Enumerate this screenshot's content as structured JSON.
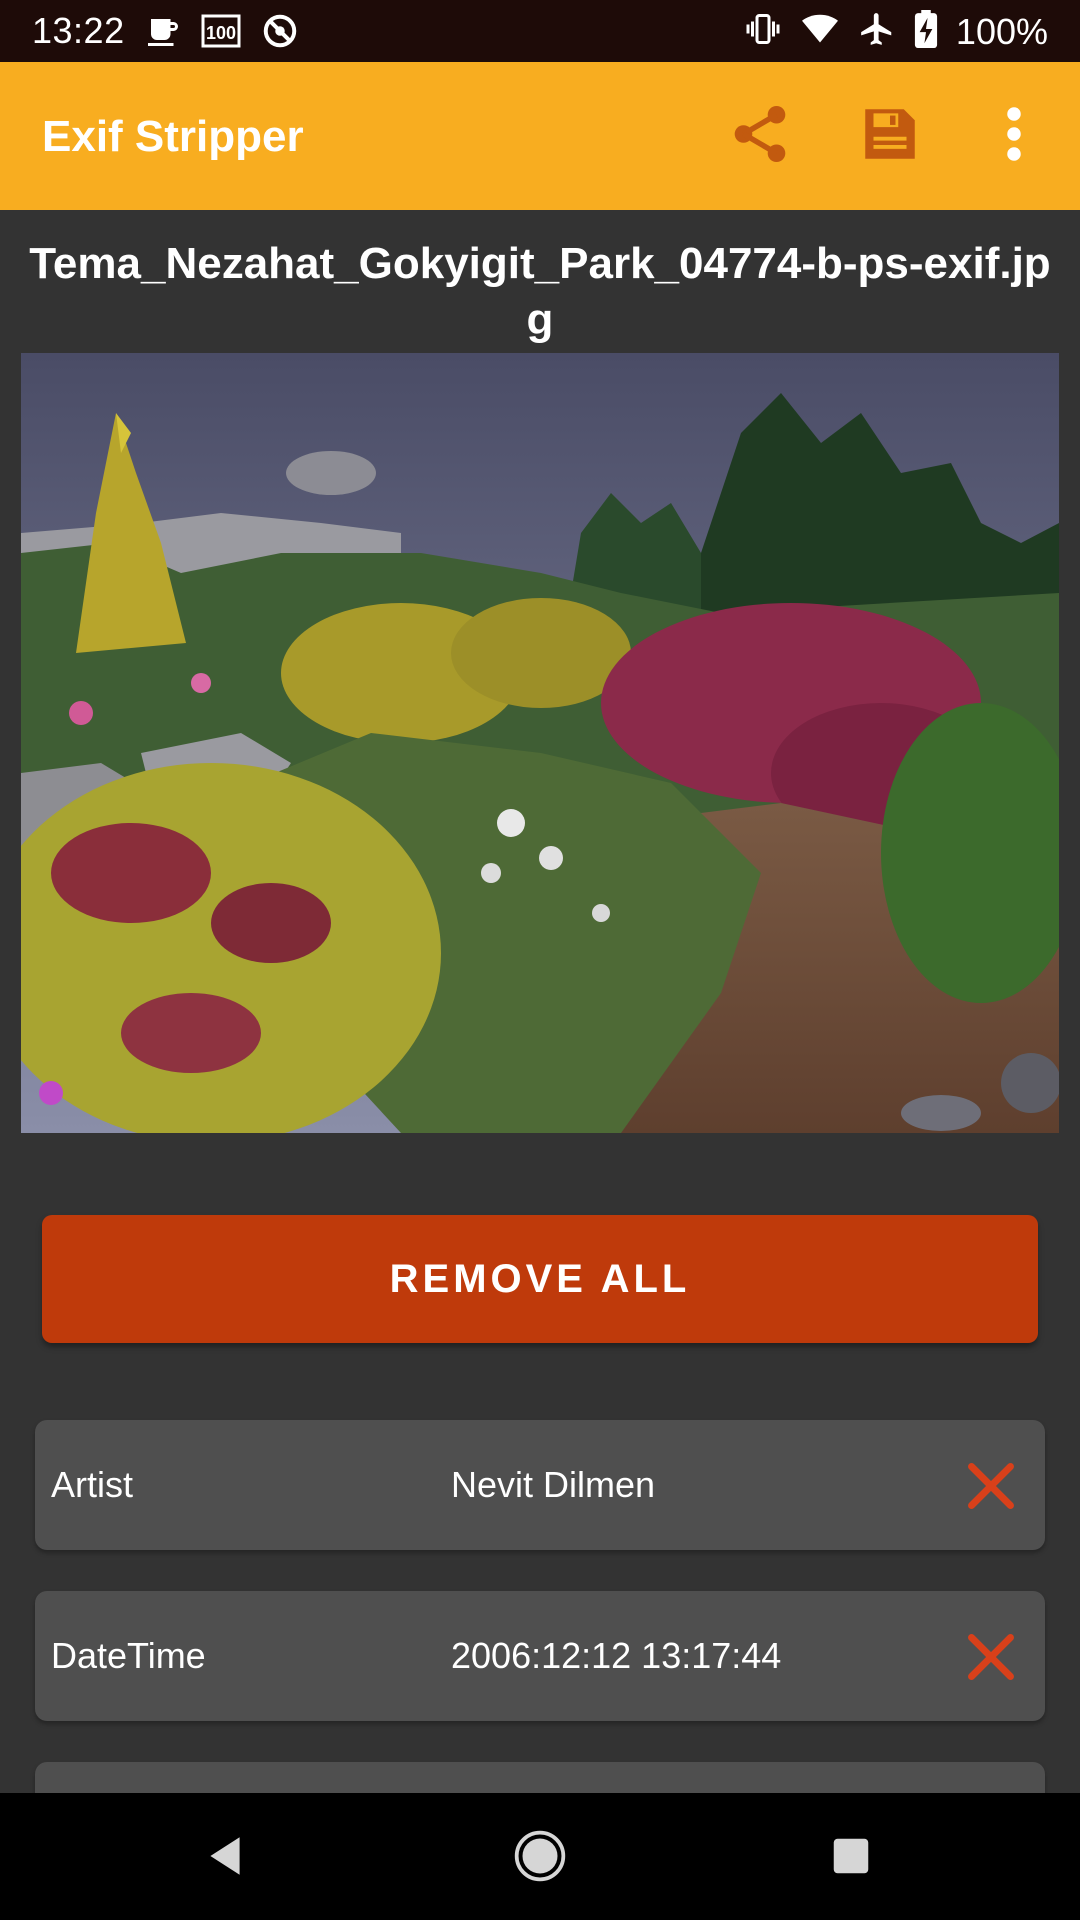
{
  "status_bar": {
    "time": "13:22",
    "left_icons": [
      "coffee-icon",
      "badge-100-icon",
      "sync-off-icon"
    ],
    "right_icons": [
      "vibrate-icon",
      "wifi-icon",
      "airplane-icon",
      "battery-charging-icon"
    ],
    "battery_text": "100%"
  },
  "app_bar": {
    "title": "Exif Stripper",
    "actions": [
      "share-icon",
      "save-icon",
      "more-vert-icon"
    ]
  },
  "file": {
    "name": "Tema_Nezahat_Gokyigit_Park_04774-b-ps-exif.jpg"
  },
  "remove_all_label": "REMOVE ALL",
  "exif": [
    {
      "key": "Artist",
      "value": "Nevit Dilmen"
    },
    {
      "key": "DateTime",
      "value": "2006:12:12 13:17:44"
    }
  ],
  "colors": {
    "app_bar": "#f8ad20",
    "accent": "#bf3a0b",
    "background": "#333333",
    "card": "#4f4f4f",
    "remove_icon": "#d8401a"
  },
  "nav_bar": {
    "buttons": [
      "back-icon",
      "home-icon",
      "recents-icon"
    ]
  }
}
